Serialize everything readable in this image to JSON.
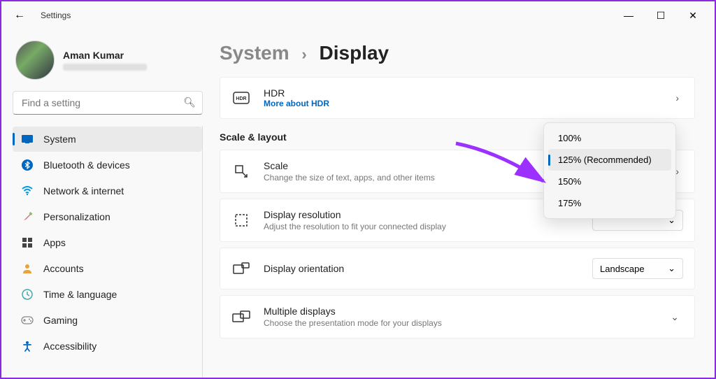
{
  "window": {
    "title": "Settings"
  },
  "profile": {
    "name": "Aman Kumar"
  },
  "search": {
    "placeholder": "Find a setting"
  },
  "nav": {
    "items": [
      {
        "label": "System",
        "active": true
      },
      {
        "label": "Bluetooth & devices"
      },
      {
        "label": "Network & internet"
      },
      {
        "label": "Personalization"
      },
      {
        "label": "Apps"
      },
      {
        "label": "Accounts"
      },
      {
        "label": "Time & language"
      },
      {
        "label": "Gaming"
      },
      {
        "label": "Accessibility"
      }
    ]
  },
  "breadcrumb": {
    "parent": "System",
    "sep": "›",
    "current": "Display"
  },
  "hdr": {
    "title": "HDR",
    "link": "More about HDR"
  },
  "section": {
    "label": "Scale & layout"
  },
  "scale": {
    "title": "Scale",
    "sub": "Change the size of text, apps, and other items",
    "options": [
      "100%",
      "125% (Recommended)",
      "150%",
      "175%"
    ],
    "selected": "125% (Recommended)"
  },
  "resolution": {
    "title": "Display resolution",
    "sub": "Adjust the resolution to fit your connected display"
  },
  "orientation": {
    "title": "Display orientation",
    "value": "Landscape"
  },
  "multiple": {
    "title": "Multiple displays",
    "sub": "Choose the presentation mode for your displays"
  }
}
